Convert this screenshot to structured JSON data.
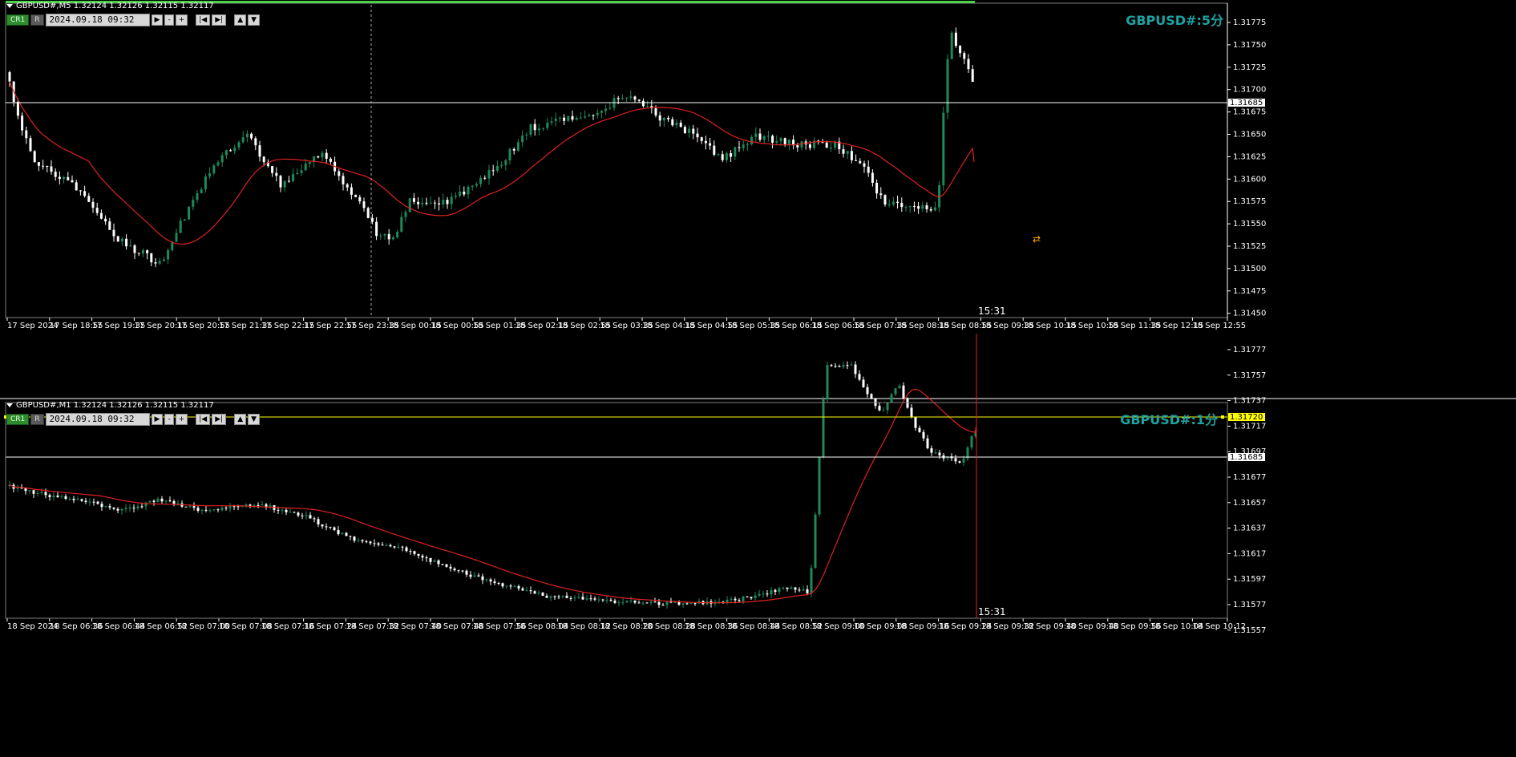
{
  "colors": {
    "bull": "#1e8a5a",
    "bear": "#ffffff",
    "ma": "#e02020",
    "hline": "#ffffff",
    "yellow": "#ffff00",
    "title": "#1fa2a2",
    "grid": "#808080"
  },
  "pane1": {
    "header": "GBPUSD#,M5  1.32124 1.32126 1.32115 1.32117",
    "title": "GBPUSD#:5分",
    "date_value": "2024.09.18 09:32",
    "cr_label": "CR1",
    "r_label": "R",
    "time_stamp": "15:31",
    "hline_price": "1.31685",
    "y_ticks": [
      "1.31775",
      "1.31750",
      "1.31725",
      "1.31700",
      "1.31675",
      "1.31650",
      "1.31625",
      "1.31600",
      "1.31575",
      "1.31550",
      "1.31525",
      "1.31500",
      "1.31475",
      "1.31450"
    ],
    "x_ticks": [
      "17 Sep 2024",
      "17 Sep 18:55",
      "17 Sep 19:35",
      "17 Sep 20:15",
      "17 Sep 20:55",
      "17 Sep 21:35",
      "17 Sep 22:15",
      "17 Sep 22:55",
      "17 Sep 23:35",
      "18 Sep 00:15",
      "18 Sep 00:55",
      "18 Sep 01:35",
      "18 Sep 02:15",
      "18 Sep 02:55",
      "18 Sep 03:35",
      "18 Sep 04:15",
      "18 Sep 04:55",
      "18 Sep 05:35",
      "18 Sep 06:15",
      "18 Sep 06:55",
      "18 Sep 07:35",
      "18 Sep 08:15",
      "18 Sep 08:55",
      "18 Sep 09:35",
      "18 Sep 10:15",
      "18 Sep 10:55",
      "18 Sep 11:35",
      "18 Sep 12:15",
      "18 Sep 12:55"
    ]
  },
  "pane2": {
    "header": "GBPUSD#,M1  1.32124 1.32126 1.32115 1.32117",
    "title": "GBPUSD#:1分",
    "date_value": "2024.09.18 09:32",
    "cr_label": "CR1",
    "r_label": "R",
    "time_stamp": "15:31",
    "hline_price": "1.31685",
    "yellow_price": "1.31720",
    "y_ticks": [
      "1.31777",
      "1.31757",
      "1.31737",
      "1.31717",
      "1.31697",
      "1.31677",
      "1.31657",
      "1.31637",
      "1.31617",
      "1.31597",
      "1.31577",
      "1.31557"
    ],
    "x_ticks": [
      "18 Sep 2024",
      "18 Sep 06:36",
      "18 Sep 06:44",
      "18 Sep 06:52",
      "18 Sep 07:00",
      "18 Sep 07:08",
      "18 Sep 07:16",
      "18 Sep 07:24",
      "18 Sep 07:32",
      "18 Sep 07:40",
      "18 Sep 07:48",
      "18 Sep 07:56",
      "18 Sep 08:04",
      "18 Sep 08:12",
      "18 Sep 08:20",
      "18 Sep 08:28",
      "18 Sep 08:36",
      "18 Sep 08:44",
      "18 Sep 08:52",
      "18 Sep 09:00",
      "18 Sep 09:08",
      "18 Sep 09:16",
      "18 Sep 09:24",
      "18 Sep 09:32",
      "18 Sep 09:40",
      "18 Sep 09:48",
      "18 Sep 09:56",
      "18 Sep 10:04",
      "18 Sep 10:12"
    ]
  }
}
